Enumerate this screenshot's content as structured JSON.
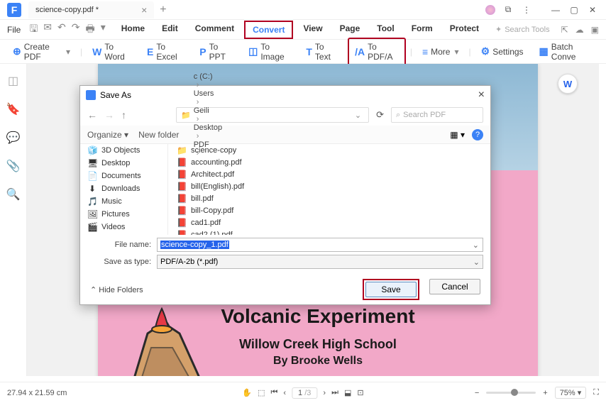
{
  "titlebar": {
    "tab_title": "science-copy.pdf *"
  },
  "menubar": {
    "file": "File",
    "items": [
      "Home",
      "Edit",
      "Comment",
      "Convert",
      "View",
      "Page",
      "Tool",
      "Form",
      "Protect"
    ],
    "active_index": 3,
    "search_placeholder": "Search Tools"
  },
  "toolbar": {
    "create_pdf": "Create PDF",
    "to_word": "To Word",
    "to_excel": "To Excel",
    "to_ppt": "To PPT",
    "to_image": "To Image",
    "to_text": "To Text",
    "to_pdfa": "To PDF/A",
    "more": "More",
    "settings": "Settings",
    "batch": "Batch Conve"
  },
  "document": {
    "title": "Volcanic Experiment",
    "subtitle1": "Willow Creek High School",
    "subtitle2": "By Brooke Wells"
  },
  "dialog": {
    "title": "Save As",
    "breadcrumbs": [
      "c (C:)",
      "Users",
      "Geili",
      "Desktop",
      "PDF"
    ],
    "search_placeholder": "Search PDF",
    "organize": "Organize",
    "new_folder": "New folder",
    "sidebar": [
      {
        "icon": "🧊",
        "label": "3D Objects"
      },
      {
        "icon": "🖥",
        "label": "Desktop"
      },
      {
        "icon": "📄",
        "label": "Documents"
      },
      {
        "icon": "⬇",
        "label": "Downloads"
      },
      {
        "icon": "🎵",
        "label": "Music"
      },
      {
        "icon": "🖼",
        "label": "Pictures"
      },
      {
        "icon": "🎬",
        "label": "Videos"
      }
    ],
    "files": [
      {
        "icon": "📁",
        "folder": true,
        "name": "science-copy"
      },
      {
        "icon": "📕",
        "name": "accounting.pdf"
      },
      {
        "icon": "📕",
        "name": "Architect.pdf"
      },
      {
        "icon": "📕",
        "name": "bill(English).pdf"
      },
      {
        "icon": "📕",
        "name": "bill.pdf"
      },
      {
        "icon": "📕",
        "name": "bill-Copy.pdf"
      },
      {
        "icon": "📕",
        "name": "cad1.pdf"
      },
      {
        "icon": "📕",
        "name": "cad2 (1).pdf"
      }
    ],
    "filename_label": "File name:",
    "filename_value": "science-copy_1.pdf",
    "savetype_label": "Save as type:",
    "savetype_value": "PDF/A-2b (*.pdf)",
    "hide_folders": "Hide Folders",
    "save": "Save",
    "cancel": "Cancel"
  },
  "statusbar": {
    "dimensions": "27.94 x 21.59 cm",
    "page": "1",
    "page_total": "/3",
    "zoom": "75%"
  }
}
